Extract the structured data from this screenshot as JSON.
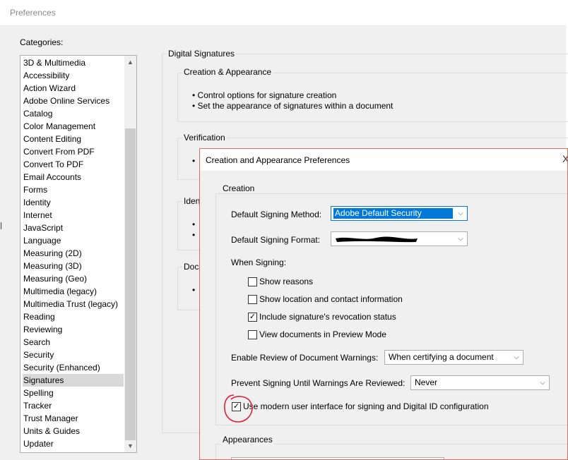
{
  "window": {
    "title": "Preferences"
  },
  "categories": {
    "label": "Categories:",
    "items": [
      "3D & Multimedia",
      "Accessibility",
      "Action Wizard",
      "Adobe Online Services",
      "Catalog",
      "Color Management",
      "Content Editing",
      "Convert From PDF",
      "Convert To PDF",
      "Email Accounts",
      "Forms",
      "Identity",
      "Internet",
      "JavaScript",
      "Language",
      "Measuring (2D)",
      "Measuring (3D)",
      "Measuring (Geo)",
      "Multimedia (legacy)",
      "Multimedia Trust (legacy)",
      "Reading",
      "Reviewing",
      "Search",
      "Security",
      "Security (Enhanced)",
      "Signatures",
      "Spelling",
      "Tracker",
      "Trust Manager",
      "Units & Guides",
      "Updater"
    ],
    "selected": "Signatures"
  },
  "digital_signatures": {
    "title": "Digital Signatures",
    "creation_appearance": {
      "title": "Creation & Appearance",
      "bullets": [
        "• Control options for signature creation",
        "• Set the appearance of signatures within a document"
      ]
    },
    "verification": {
      "title": "Verification",
      "bullet": "•"
    },
    "identity_partial": {
      "title": "Iden",
      "bullets": [
        "•",
        "•"
      ]
    },
    "document_partial": {
      "title": "Doc",
      "bullet": "•"
    }
  },
  "dialog": {
    "title": "Creation and Appearance Preferences",
    "close": "X",
    "creation_group": "Creation",
    "default_signing_method_label": "Default Signing Method:",
    "default_signing_method_value": "Adobe Default Security",
    "default_signing_format_label": "Default Signing Format:",
    "default_signing_format_value": "",
    "when_signing_label": "When Signing:",
    "options": [
      {
        "label": "Show reasons",
        "checked": false
      },
      {
        "label": "Show location and contact information",
        "checked": false
      },
      {
        "label": "Include signature's revocation status",
        "checked": true
      },
      {
        "label": "View documents in Preview Mode",
        "checked": false
      }
    ],
    "enable_review_label": "Enable Review of Document Warnings:",
    "enable_review_value": "When certifying a document",
    "prevent_signing_label": "Prevent Signing Until Warnings Are Reviewed:",
    "prevent_signing_value": "Never",
    "modern_ui_label": "Use modern user interface for signing and Digital ID configuration",
    "modern_ui_checked": true,
    "appearances_group": "Appearances",
    "checkmark": "✓",
    "dropdown_arrow": "⌵"
  },
  "colors": {
    "accent": "#0078d7",
    "annotation": "#e0203a",
    "dialog_border": "#e36b5c"
  }
}
